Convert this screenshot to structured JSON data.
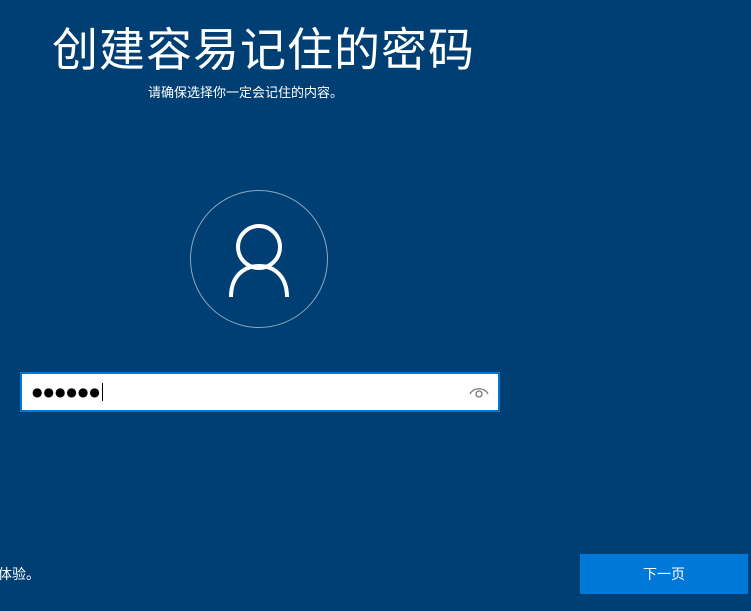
{
  "header": {
    "title": "创建容易记住的密码",
    "subtitle": "请确保选择你一定会记住的内容。"
  },
  "avatar": {
    "icon": "user-icon"
  },
  "password": {
    "masked_value": "●●●●●●",
    "reveal_icon": "eye-icon"
  },
  "footer": {
    "partial_text": "体验。"
  },
  "actions": {
    "next_label": "下一页"
  },
  "colors": {
    "background": "#003f74",
    "accent": "#0078d7",
    "text": "#ffffff"
  }
}
